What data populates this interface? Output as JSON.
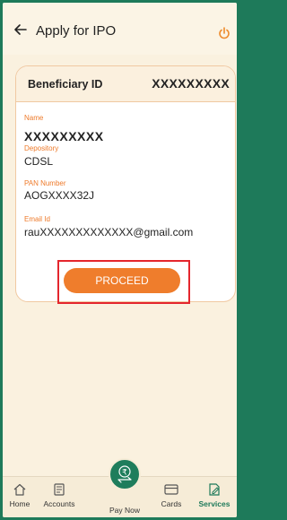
{
  "header": {
    "title": "Apply for IPO",
    "back_icon": "arrow-left-icon",
    "logout_icon": "power-icon",
    "accent": "#ee7a2a"
  },
  "beneficiary": {
    "label": "Beneficiary ID",
    "value": "XXXXXXXXX"
  },
  "fields": {
    "name_label": "Name",
    "name_value": "XXXXXXXXX",
    "depository_label": "Depository",
    "depository_value": "CDSL",
    "pan_label": "PAN Number",
    "pan_value": "AOGXXXX32J",
    "email_label": "Email Id",
    "email_value": "rauXXXXXXXXXXXXX@gmail.com"
  },
  "proceed_label": "PROCEED",
  "nav": {
    "home": "Home",
    "accounts": "Accounts",
    "paynow": "Pay Now",
    "cards": "Cards",
    "services": "Services",
    "active": "Services",
    "active_color": "#1e7a5a"
  }
}
